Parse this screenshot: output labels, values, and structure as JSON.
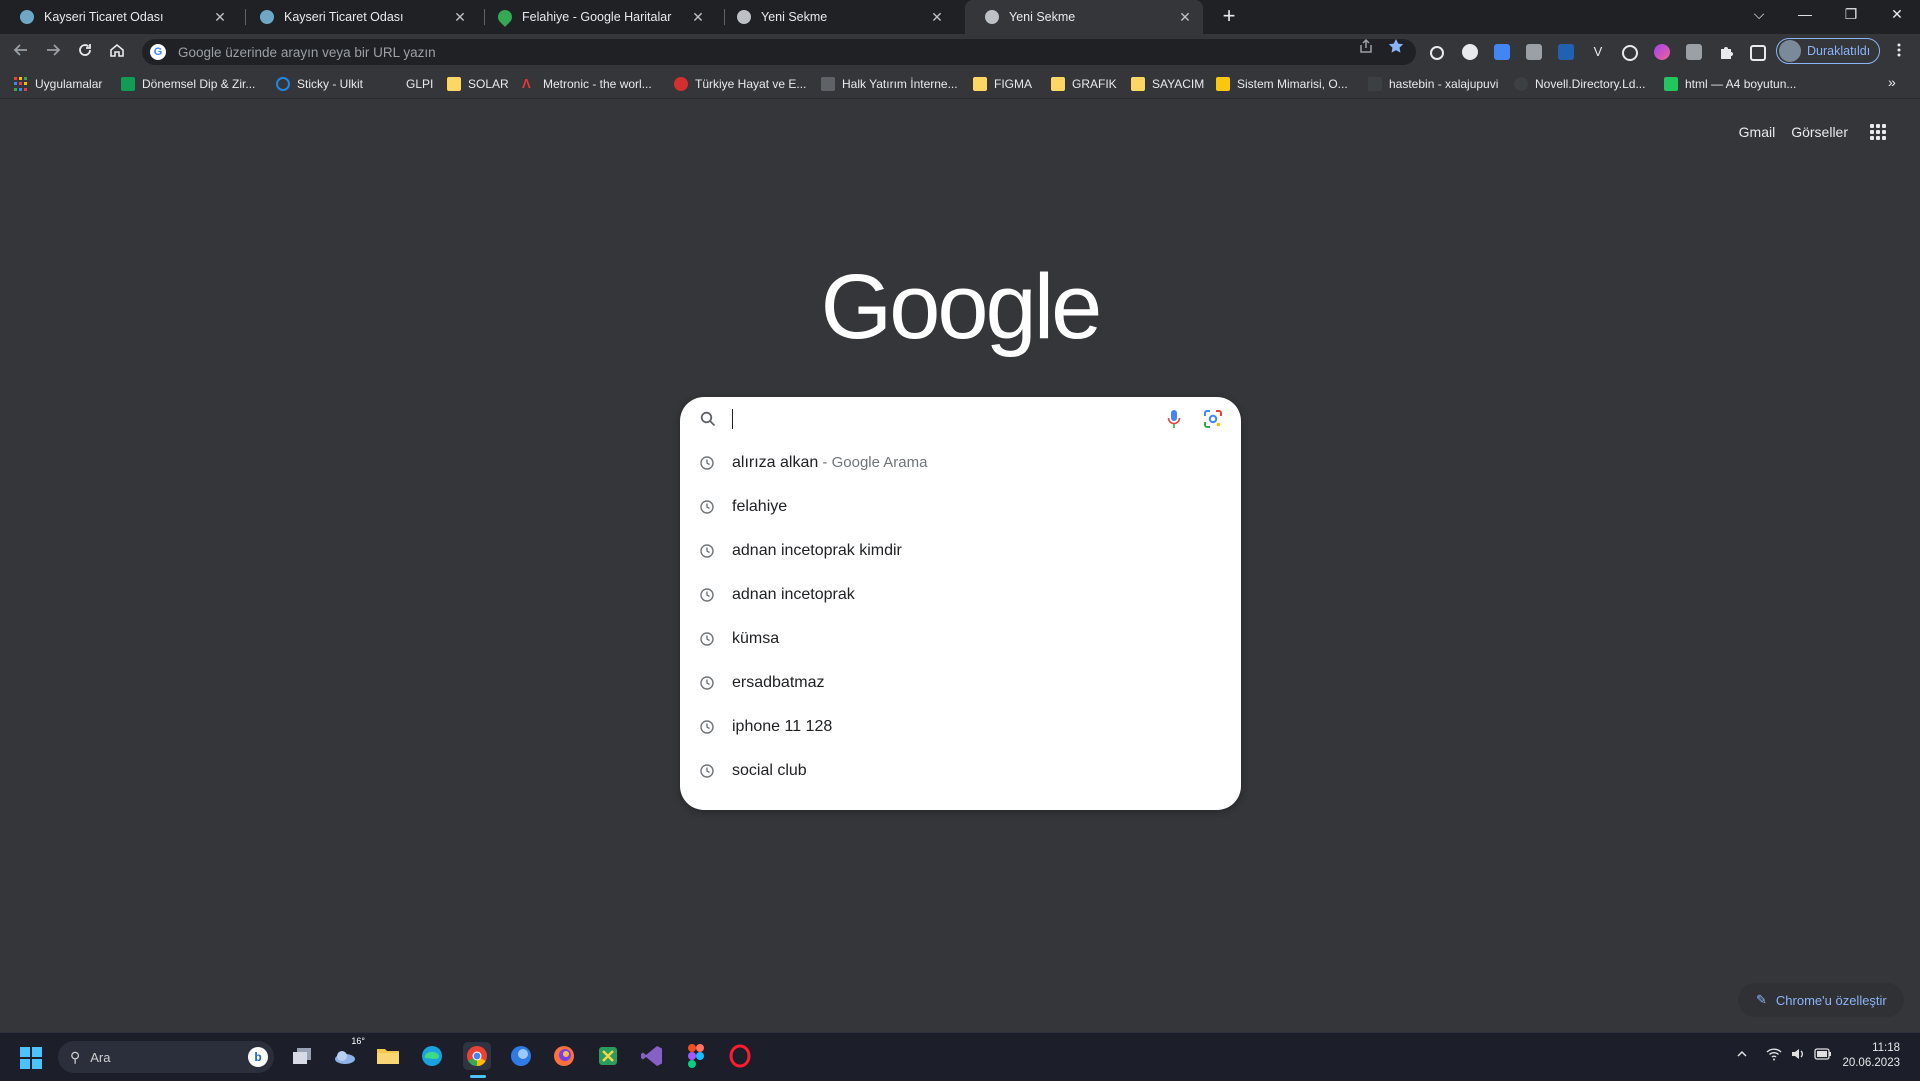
{
  "browser": {
    "tabs": [
      {
        "title": "Kayseri Ticaret Odası",
        "favicon_color": "#6fa8c7",
        "active": false
      },
      {
        "title": "Kayseri Ticaret Odası",
        "favicon_color": "#6fa8c7",
        "active": false
      },
      {
        "title": "Felahiye - Google Haritalar",
        "favicon_color": "#34a853",
        "active": false
      },
      {
        "title": "Yeni Sekme",
        "favicon_color": "#bdc1c6",
        "active": false
      },
      {
        "title": "Yeni Sekme",
        "favicon_color": "#bdc1c6",
        "active": true
      }
    ],
    "tab_close_glyph": "✕",
    "new_tab_glyph": "+",
    "window_controls": {
      "tab_search": "⌵",
      "minimize": "—",
      "restore": "❐",
      "close": "✕"
    },
    "omnibox": {
      "placeholder": "Google üzerinde arayın veya bir URL yazın",
      "value": ""
    },
    "profile": {
      "label": "Duraklatıldı"
    },
    "bookmarks": [
      {
        "label": "Uygulamalar",
        "color": "#ea4335"
      },
      {
        "label": "Dönemsel Dip & Zir...",
        "color": "#0f9d58"
      },
      {
        "label": "Sticky - Ulkit",
        "color": "#1e88e5"
      },
      {
        "label": "GLPI",
        "color": "#35363a"
      },
      {
        "label": "SOLAR",
        "color": "#fdd663"
      },
      {
        "label": "Metronic - the worl...",
        "color": "#e53935"
      },
      {
        "label": "Türkiye Hayat ve E...",
        "color": "#d32f2f"
      },
      {
        "label": "Halk Yatırım İnterne...",
        "color": "#5f6368"
      },
      {
        "label": "FIGMA",
        "color": "#fdd663"
      },
      {
        "label": "GRAFIK",
        "color": "#fdd663"
      },
      {
        "label": "SAYACIM",
        "color": "#fdd663"
      },
      {
        "label": "Sistem Mimarisi, O...",
        "color": "#f9c80e"
      },
      {
        "label": "hastebin - xalajupuvi",
        "color": "#3c4043"
      },
      {
        "label": "Novell.Directory.Ld...",
        "color": "#3c4043"
      },
      {
        "label": "html — A4 boyutun...",
        "color": "#22c55e"
      }
    ],
    "bookmarks_more": "»"
  },
  "page": {
    "top_links": {
      "gmail": "Gmail",
      "images": "Görseller"
    },
    "logo": "Google",
    "search": {
      "value": ""
    },
    "suggestions": [
      {
        "text": "alırıza alkan",
        "subtext": " - Google Arama"
      },
      {
        "text": "felahiye",
        "subtext": ""
      },
      {
        "text": "adnan incetoprak kimdir",
        "subtext": ""
      },
      {
        "text": "adnan incetoprak",
        "subtext": ""
      },
      {
        "text": "kümsa",
        "subtext": ""
      },
      {
        "text": "ersadbatmaz",
        "subtext": ""
      },
      {
        "text": "iphone 11 128",
        "subtext": ""
      },
      {
        "text": "social club",
        "subtext": ""
      }
    ],
    "customize_label": "Chrome'u özelleştir"
  },
  "taskbar": {
    "search_label": "Ara",
    "weather_badge": "16°",
    "clock": {
      "time": "11:18",
      "date": "20.06.2023"
    },
    "apps": [
      "task-view",
      "widgets",
      "file-explorer",
      "edge",
      "chrome",
      "app-blue",
      "firefox",
      "app-green",
      "visual-studio",
      "figma",
      "opera"
    ]
  }
}
